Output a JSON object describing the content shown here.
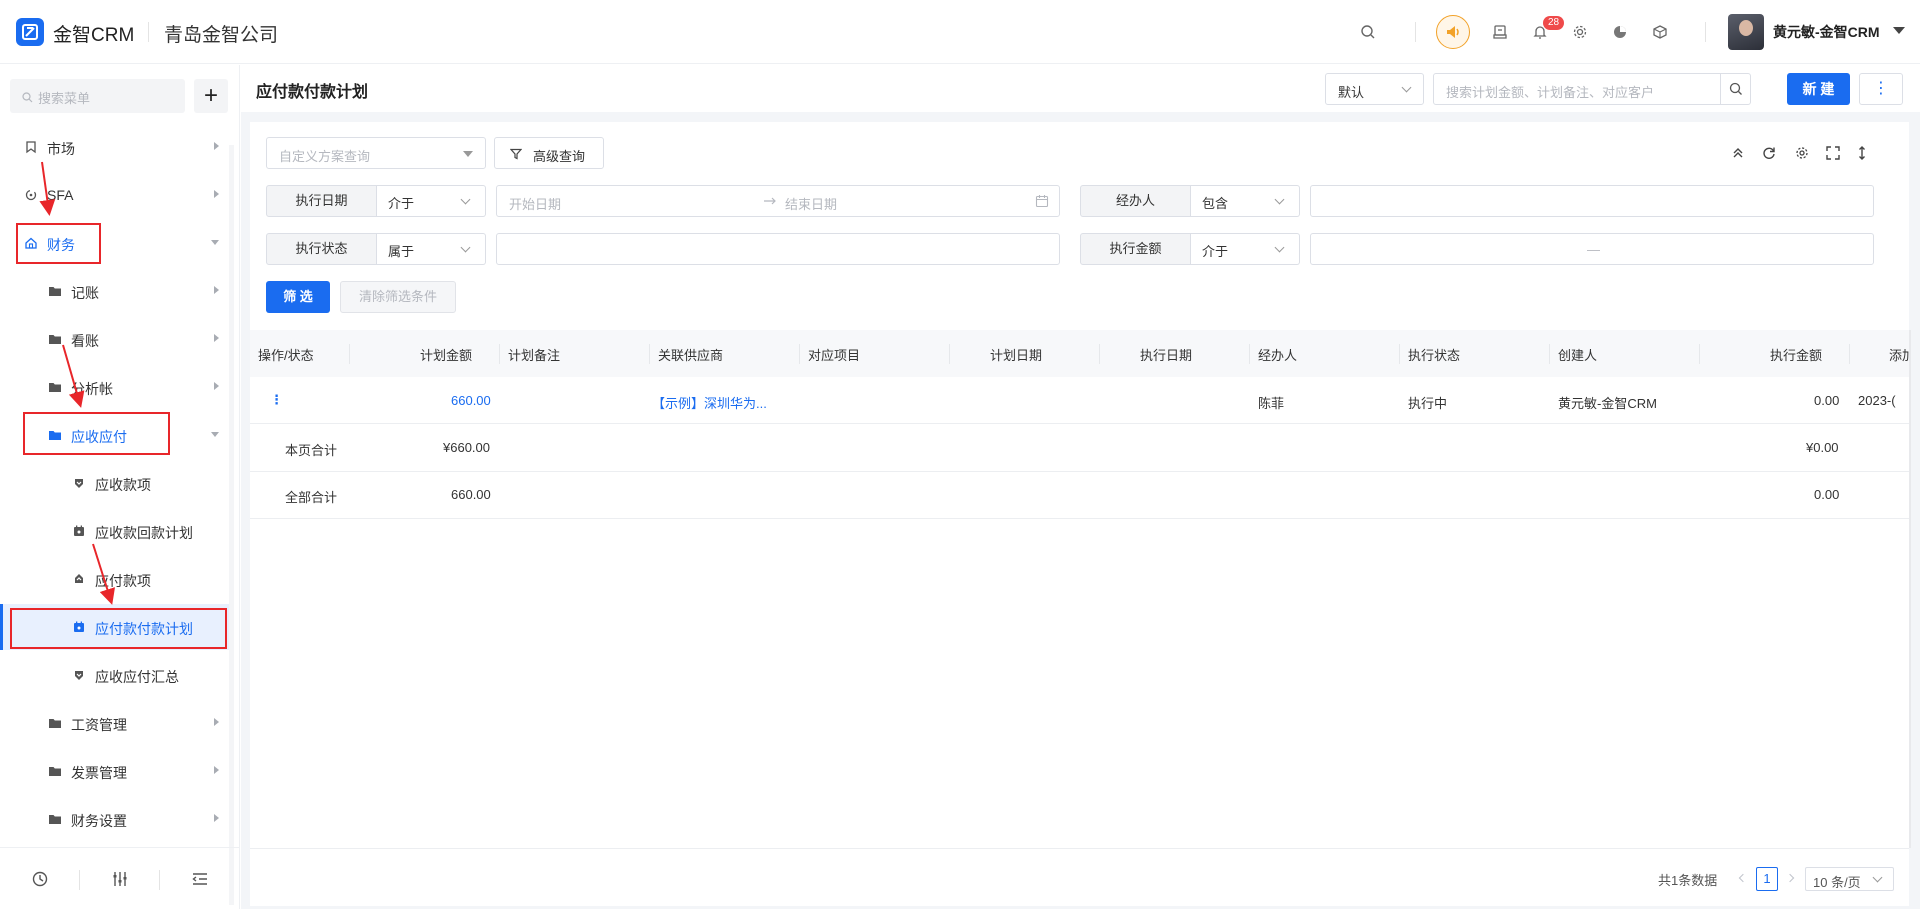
{
  "app": {
    "brand": "金智CRM",
    "company": "青岛金智公司",
    "accent": "#1a6cf0",
    "annotation_color": "#e8262a"
  },
  "topbar": {
    "notification_count": "28",
    "user_name": "黄元敏-金智CRM",
    "icons": [
      "search-icon",
      "megaphone-icon",
      "inbox-icon",
      "bell-icon",
      "gear-icon",
      "pie-chart-icon",
      "cube-icon"
    ]
  },
  "sidebar": {
    "search_placeholder": "搜索菜单",
    "add_label": "+",
    "items": [
      {
        "label": "市场",
        "icon": "bookmark-icon",
        "level": 1
      },
      {
        "label": "SFA",
        "icon": "refresh-icon",
        "level": 1
      },
      {
        "label": "财务",
        "icon": "home-icon",
        "level": 1,
        "expanded": true
      },
      {
        "label": "记账",
        "icon": "folder-icon",
        "level": 2
      },
      {
        "label": "看账",
        "icon": "folder-icon",
        "level": 2
      },
      {
        "label": "分析帐",
        "icon": "folder-icon",
        "level": 2
      },
      {
        "label": "应收应付",
        "icon": "folder-icon",
        "level": 2,
        "expanded": true
      },
      {
        "label": "应收款项",
        "icon": "arrow-down-box-icon",
        "level": 3
      },
      {
        "label": "应收款回款计划",
        "icon": "calendar-icon",
        "level": 3
      },
      {
        "label": "应付款项",
        "icon": "arrow-up-box-icon",
        "level": 3
      },
      {
        "label": "应付款付款计划",
        "icon": "calendar-icon",
        "level": 3,
        "active": true
      },
      {
        "label": "应收应付汇总",
        "icon": "arrow-down-box-icon",
        "level": 3
      },
      {
        "label": "工资管理",
        "icon": "folder-icon",
        "level": 2
      },
      {
        "label": "发票管理",
        "icon": "folder-icon",
        "level": 2
      },
      {
        "label": "财务设置",
        "icon": "folder-icon",
        "level": 2
      }
    ],
    "bottom_icons": [
      "history-icon",
      "sliders-icon",
      "collapse-menu-icon"
    ]
  },
  "header": {
    "title": "应付款付款计划",
    "view_select": "默认",
    "search_placeholder": "搜索计划金额、计划备注、对应客户",
    "new_label": "新 建",
    "more_label": "⋮"
  },
  "filters": {
    "scheme_placeholder": "自定义方案查询",
    "advanced_label": "高级查询",
    "exec_date": {
      "label": "执行日期",
      "op": "介于",
      "start_placeholder": "开始日期",
      "end_placeholder": "结束日期"
    },
    "handler": {
      "label": "经办人",
      "op": "包含",
      "value": ""
    },
    "exec_status": {
      "label": "执行状态",
      "op": "属于",
      "value": ""
    },
    "exec_amount": {
      "label": "执行金额",
      "op": "介于",
      "separator": "—"
    },
    "apply_label": "筛 选",
    "clear_label": "清除筛选条件"
  },
  "table": {
    "columns": [
      "操作/状态",
      "计划金额",
      "计划备注",
      "关联供应商",
      "对应项目",
      "计划日期",
      "执行日期",
      "经办人",
      "执行状态",
      "创建人",
      "执行金额",
      "添加"
    ],
    "rows": [
      {
        "action": "⋮",
        "plan_amount": "660.00",
        "note": "",
        "supplier": "【示例】深圳华为...",
        "project": "",
        "plan_date": "",
        "exec_date": "",
        "handler": "陈菲",
        "status": "执行中",
        "creator": "黄元敏-金智CRM",
        "exec_amount": "0.00",
        "added": "2023-("
      }
    ],
    "page_total": {
      "label": "本页合计",
      "plan_amount": "¥660.00",
      "exec_amount": "¥0.00"
    },
    "all_total": {
      "label": "全部合计",
      "plan_amount": "660.00",
      "exec_amount": "0.00"
    }
  },
  "pagination": {
    "total": "共1条数据",
    "current": "1",
    "page_size": "10 条/页"
  }
}
